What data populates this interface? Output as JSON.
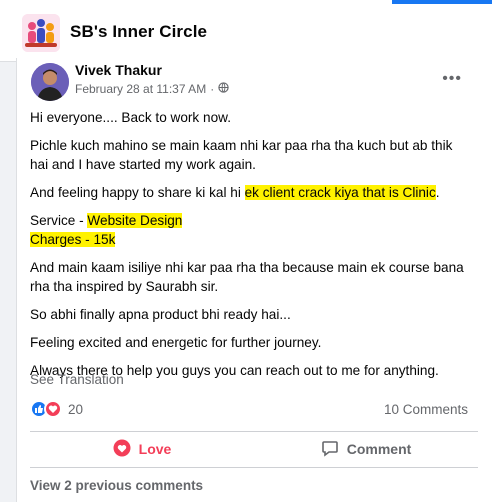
{
  "group": {
    "name": "SB's Inner Circle"
  },
  "post": {
    "author": "Vivek Thakur",
    "timestamp": "February 28 at 11:37 AM",
    "audience_icon": "globe-icon",
    "more_icon": "more-options-icon",
    "paragraphs": {
      "p1": "Hi everyone.... Back to work now.",
      "p2": "Pichle kuch mahino se main kaam nhi kar paa rha tha kuch but ab thik hai and I have started my work again.",
      "p3_pre": "And feeling happy to share ki kal hi ",
      "p3_hl": "ek client crack kiya that is Clinic",
      "p3_post": ".",
      "p4_pre": "Service - ",
      "p4_hl": "Website Design",
      "p5_hl": "Charges - 15k",
      "p6": "And main kaam isiliye nhi kar paa rha tha because main ek course bana rha tha inspired by Saurabh sir.",
      "p7": "So abhi finally apna product bhi ready hai...",
      "p8": "Feeling excited and energetic for further journey.",
      "p9": "Always there to help you guys you can reach out to me for anything."
    },
    "see_translation": "See Translation",
    "reaction_count": "20",
    "comment_count": "10 Comments",
    "actions": {
      "love": "Love",
      "comment": "Comment"
    },
    "view_previous": "View 2 previous comments"
  },
  "colors": {
    "highlight": "#fff200",
    "love": "#f33e58",
    "like": "#1877f2"
  }
}
